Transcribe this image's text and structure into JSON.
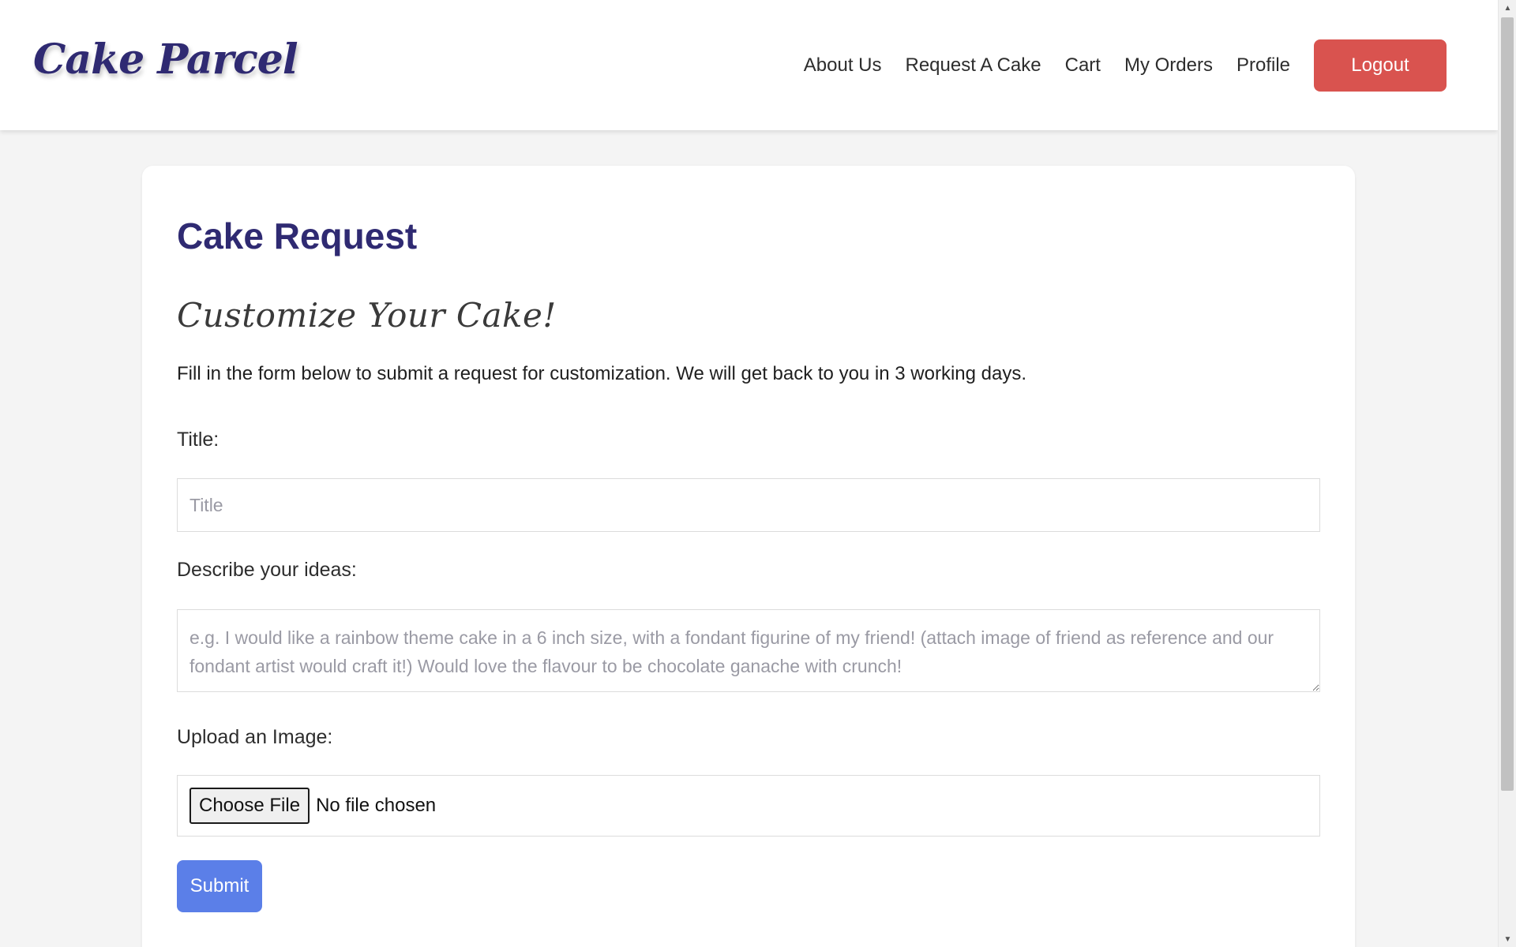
{
  "navbar": {
    "logo": "Cake Parcel",
    "links": [
      "About Us",
      "Request A Cake",
      "Cart",
      "My Orders",
      "Profile"
    ],
    "logout_label": "Logout"
  },
  "form": {
    "title": "Cake Request",
    "subtitle": "Customize Your Cake!",
    "intro": "Fill in the form below to submit a request for customization. We will get back to you in 3 working days.",
    "title_label": "Title:",
    "title_placeholder": "Title",
    "title_value": "",
    "ideas_label": "Describe your ideas:",
    "ideas_placeholder": "e.g. I would like a rainbow theme cake in a 6 inch size, with a fondant figurine of my friend! (attach image of friend as reference and our fondant artist would craft it!) Would love the flavour to be chocolate ganache with crunch!",
    "ideas_value": "",
    "upload_label": "Upload an Image:",
    "choose_file_label": "Choose File",
    "file_status": "No file chosen",
    "submit_label": "Submit"
  },
  "colors": {
    "brand": "#2f2a72",
    "logout": "#d9534f",
    "submit": "#5b7fe8",
    "background": "#f4f4f4"
  }
}
